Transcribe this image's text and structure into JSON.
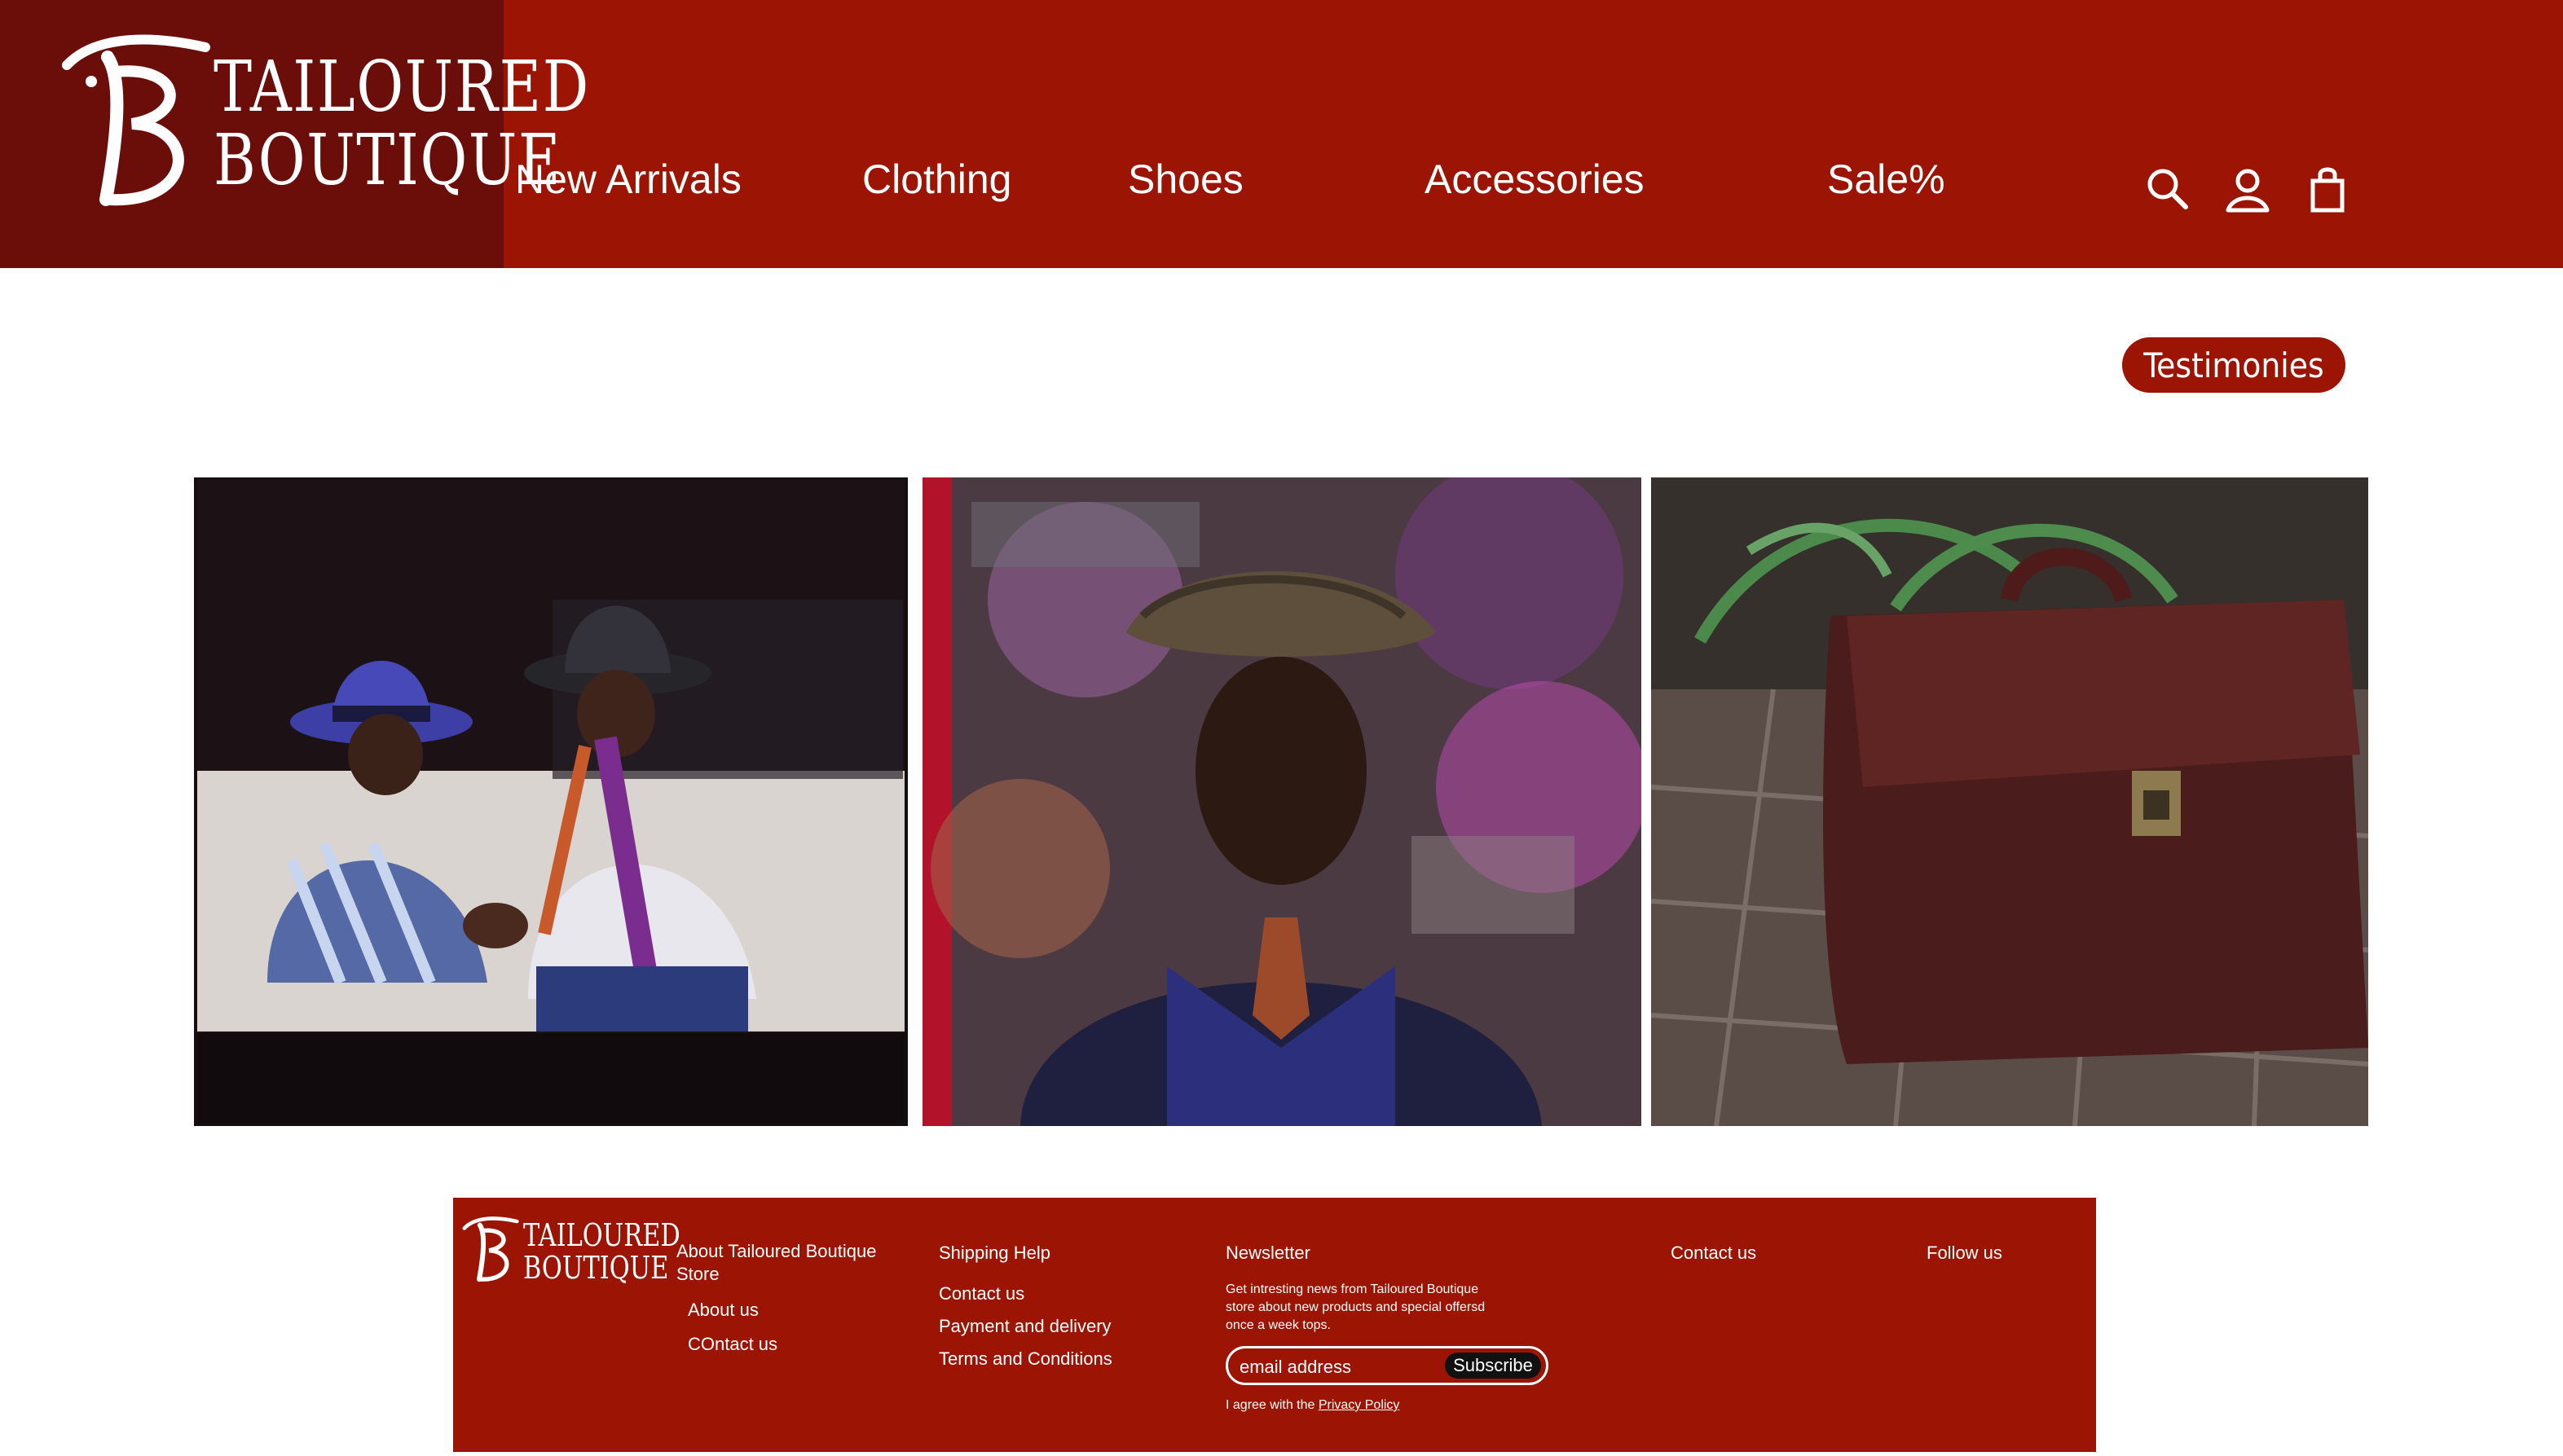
{
  "brand": {
    "line1": "TAILOURED",
    "line2": "BOUTIQUE",
    "colors": {
      "primary": "#9c1504",
      "logo_bg": "#6b0d08"
    }
  },
  "nav": {
    "items": [
      {
        "label": "New Arrivals"
      },
      {
        "label": "Clothing"
      },
      {
        "label": "Shoes"
      },
      {
        "label": "Accessories"
      },
      {
        "label": "Sale%"
      }
    ],
    "icons": [
      "search-icon",
      "user-icon",
      "shopping-bag-icon"
    ]
  },
  "testimonies": {
    "label": "Testimonies"
  },
  "footer": {
    "about": {
      "heading": "About Tailoured Boutique Store",
      "links": [
        "About us",
        "COntact us"
      ]
    },
    "shipping": {
      "heading": "Shipping Help",
      "links": [
        "Contact us",
        "Payment and delivery",
        "Terms and Conditions"
      ]
    },
    "newsletter": {
      "heading": "Newsletter",
      "text": "Get intresting news  from Tailoured Boutique store about new products and special offersd once a week tops.",
      "placeholder": "email address",
      "button": "Subscribe",
      "agree_prefix": "I agree with the ",
      "agree_link": "Privacy Policy"
    },
    "contact": {
      "heading": "Contact us"
    },
    "follow": {
      "heading": "Follow us"
    }
  }
}
